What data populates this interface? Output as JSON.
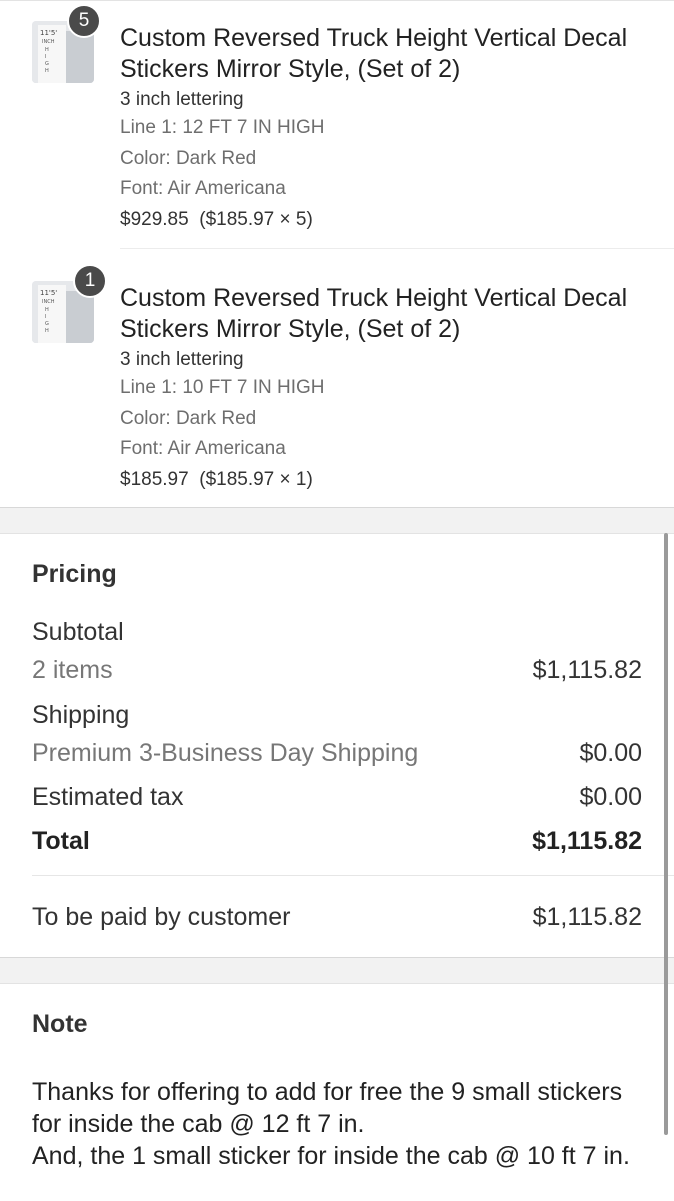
{
  "line_items": [
    {
      "quantity": "5",
      "title": "Custom Reversed Truck Height Vertical Decal Stickers Mirror Style, (Set of 2)",
      "variant": "3 inch lettering",
      "line1": "Line 1: 12 FT 7 IN HIGH",
      "color": "Color: Dark Red",
      "font": "Font: Air Americana",
      "price": "$929.85  ($185.97 × 5)",
      "thumb_text": "11'5' INCH HIGH"
    },
    {
      "quantity": "1",
      "title": "Custom Reversed Truck Height Vertical Decal Stickers Mirror Style, (Set of 2)",
      "variant": "3 inch lettering",
      "line1": "Line 1: 10 FT 7 IN HIGH",
      "color": "Color: Dark Red",
      "font": "Font: Air Americana",
      "price": "$185.97  ($185.97 × 1)",
      "thumb_text": "11'5' INCH HIGH"
    }
  ],
  "pricing": {
    "title": "Pricing",
    "subtotal_label": "Subtotal",
    "subtotal_sub": "2 items",
    "subtotal_value": "$1,115.82",
    "shipping_label": "Shipping",
    "shipping_sub": "Premium 3-Business Day Shipping",
    "shipping_value": "$0.00",
    "tax_label": "Estimated tax",
    "tax_value": "$0.00",
    "total_label": "Total",
    "total_value": "$1,115.82",
    "paid_label": "To be paid by customer",
    "paid_value": "$1,115.82"
  },
  "note": {
    "title": "Note",
    "text": "Thanks for offering to add for free the 9 small stickers for inside the cab @ 12 ft 7 in.\nAnd, the 1 small sticker for inside the cab @ 10 ft 7 in."
  },
  "colors": {
    "background": "#f2f2f2",
    "card": "#ffffff",
    "badge": "#4a4a4a"
  }
}
